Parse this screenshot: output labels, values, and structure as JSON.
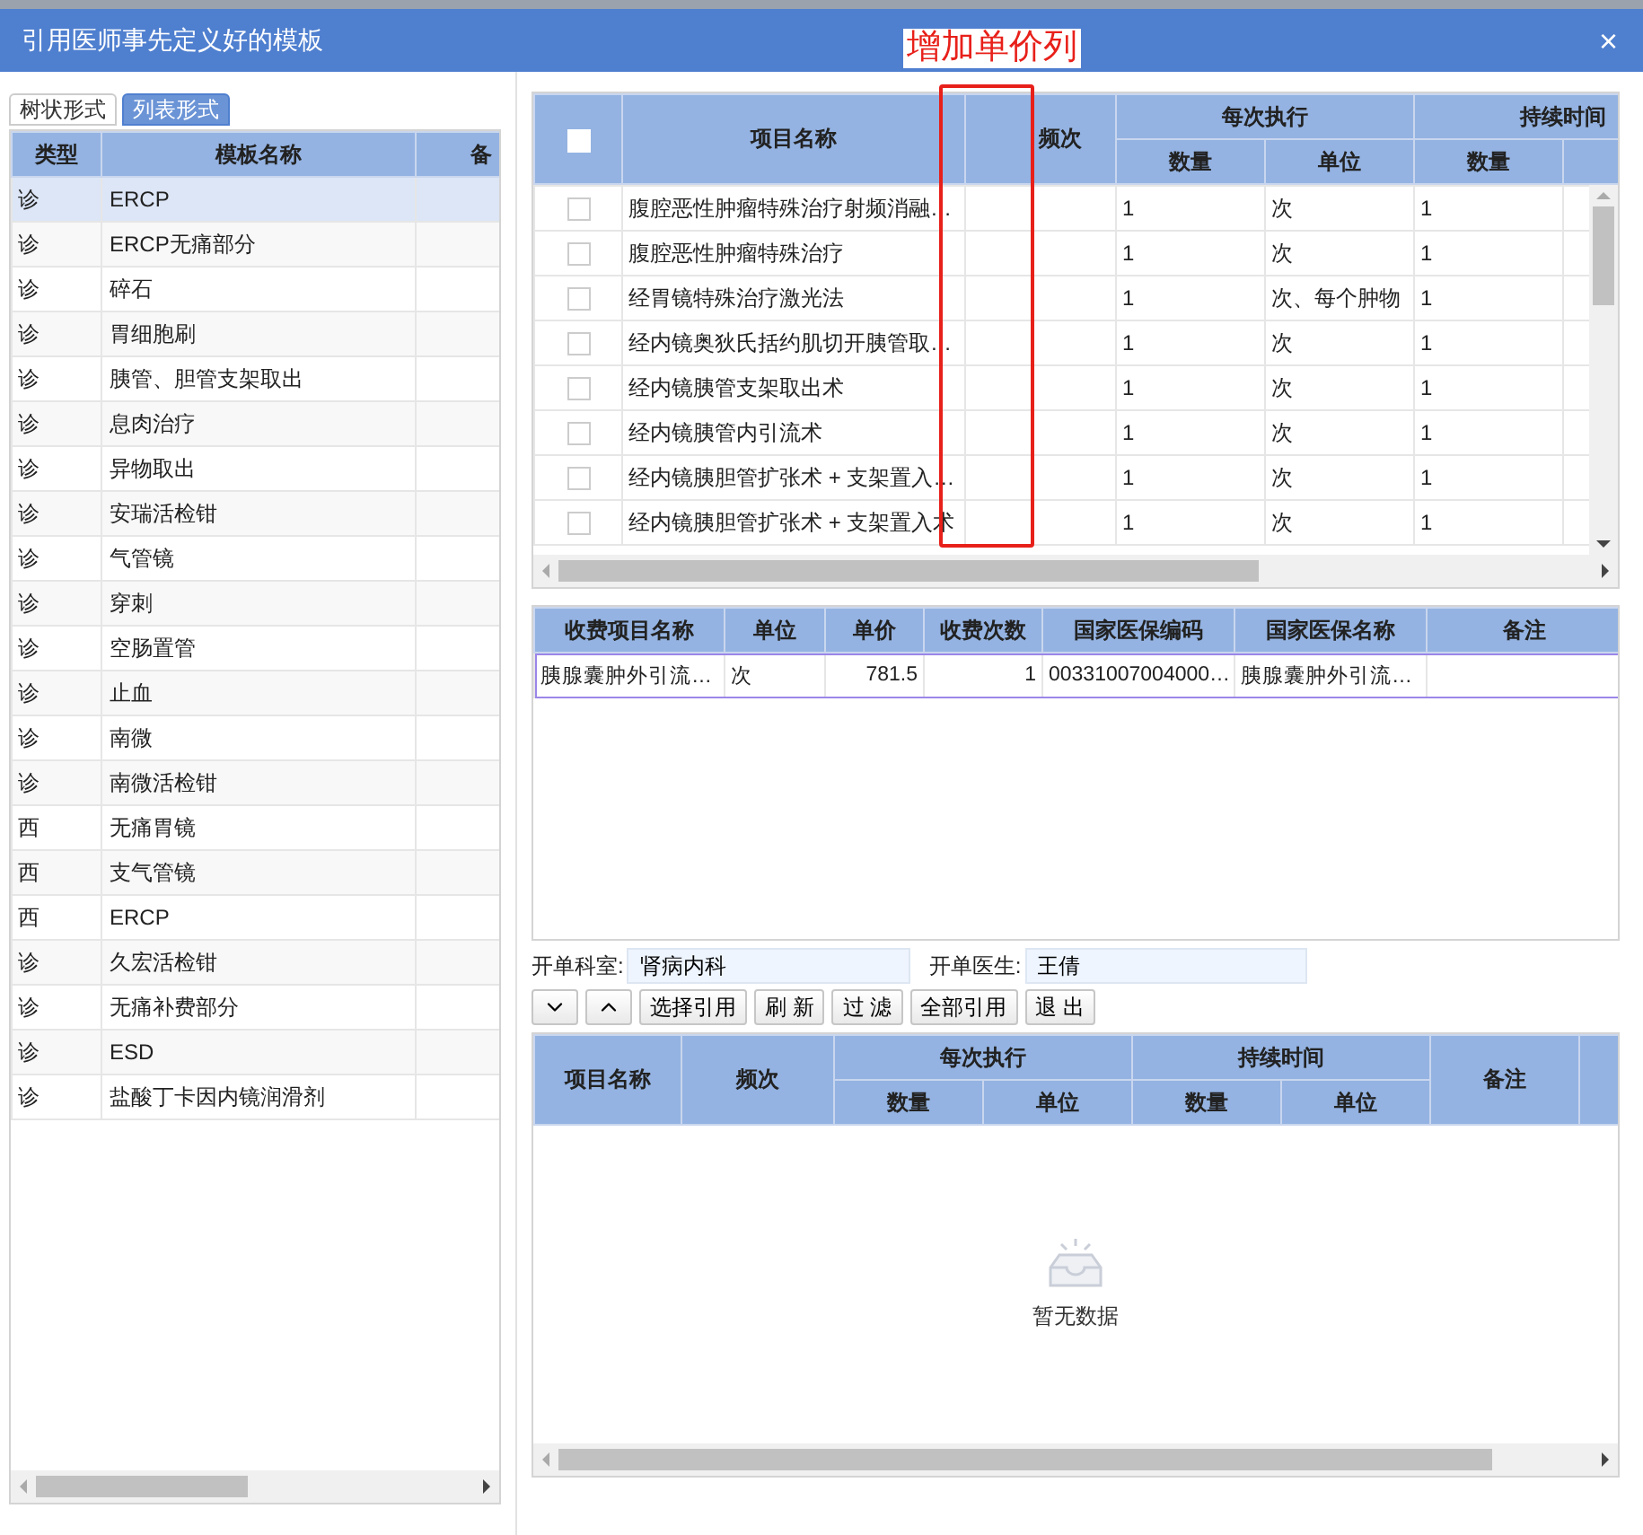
{
  "window": {
    "title": "引用医师事先定义好的模板",
    "close": "×"
  },
  "annotation": {
    "text": "增加单价列"
  },
  "templates": {
    "tabs": [
      {
        "label": "树状形式",
        "selected": false
      },
      {
        "label": "列表形式",
        "selected": true
      }
    ],
    "columns": [
      "类型",
      "模板名称",
      "备"
    ],
    "rows": [
      {
        "type": "诊",
        "name": "ERCP",
        "selected": true
      },
      {
        "type": "诊",
        "name": "ERCP无痛部分",
        "selected": false
      },
      {
        "type": "诊",
        "name": "碎石",
        "selected": false
      },
      {
        "type": "诊",
        "name": "胃细胞刷",
        "selected": false
      },
      {
        "type": "诊",
        "name": "胰管、胆管支架取出",
        "selected": false
      },
      {
        "type": "诊",
        "name": "息肉治疗",
        "selected": false
      },
      {
        "type": "诊",
        "name": "异物取出",
        "selected": false
      },
      {
        "type": "诊",
        "name": "安瑞活检钳",
        "selected": false
      },
      {
        "type": "诊",
        "name": "气管镜",
        "selected": false
      },
      {
        "type": "诊",
        "name": "穿刺",
        "selected": false
      },
      {
        "type": "诊",
        "name": "空肠置管",
        "selected": false
      },
      {
        "type": "诊",
        "name": "止血",
        "selected": false
      },
      {
        "type": "诊",
        "name": "南微",
        "selected": false
      },
      {
        "type": "诊",
        "name": "南微活检钳",
        "selected": false
      },
      {
        "type": "西",
        "name": "无痛胃镜",
        "selected": false
      },
      {
        "type": "西",
        "name": "支气管镜",
        "selected": false
      },
      {
        "type": "西",
        "name": "ERCP",
        "selected": false
      },
      {
        "type": "诊",
        "name": "久宏活检钳",
        "selected": false
      },
      {
        "type": "诊",
        "name": "无痛补费部分",
        "selected": false
      },
      {
        "type": "诊",
        "name": "ESD",
        "selected": false
      },
      {
        "type": "诊",
        "name": "盐酸丁卡因内镜润滑剂",
        "selected": false
      }
    ]
  },
  "items": {
    "header": {
      "name": "项目名称",
      "frequency": "频次",
      "per_time": "每次执行",
      "duration": "持续时间",
      "sub": [
        "数量",
        "单位",
        "数量"
      ]
    },
    "all_checked": false,
    "rows": [
      {
        "checked": false,
        "name": "腹腔恶性肿瘤特殊治疗射频消融…",
        "quantity": "1",
        "unit": "次",
        "duration": "1"
      },
      {
        "checked": false,
        "name": "腹腔恶性肿瘤特殊治疗",
        "quantity": "1",
        "unit": "次",
        "duration": "1"
      },
      {
        "checked": false,
        "name": "经胃镜特殊治疗激光法",
        "quantity": "1",
        "unit": "次、每个肿物",
        "duration": "1"
      },
      {
        "checked": false,
        "name": "经内镜奥狄氏括约肌切开胰管取…",
        "quantity": "1",
        "unit": "次",
        "duration": "1"
      },
      {
        "checked": false,
        "name": "经内镜胰管支架取出术",
        "quantity": "1",
        "unit": "次",
        "duration": "1"
      },
      {
        "checked": false,
        "name": "经内镜胰管内引流术",
        "quantity": "1",
        "unit": "次",
        "duration": "1"
      },
      {
        "checked": false,
        "name": "经内镜胰胆管扩张术 + 支架置入…",
        "quantity": "1",
        "unit": "次",
        "duration": "1"
      },
      {
        "checked": false,
        "name": "经内镜胰胆管扩张术 + 支架置入术",
        "quantity": "1",
        "unit": "次",
        "duration": "1"
      }
    ]
  },
  "charges": {
    "columns": [
      "收费项目名称",
      "单位",
      "单价",
      "收费次数",
      "国家医保编码",
      "国家医保名称",
      "备注"
    ],
    "rows": [
      {
        "selected": true,
        "cells": [
          "胰腺囊肿外引流…",
          "次",
          "781.5",
          "1",
          "00331007004000…",
          "胰腺囊肿外引流…"
        ]
      }
    ]
  },
  "form": [
    {
      "label": "开单科室:",
      "value": "肾病内科"
    },
    {
      "label": "开单医生:",
      "value": "王倩"
    }
  ],
  "buttons": [
    {
      "kind": "down"
    },
    {
      "kind": "up"
    },
    {
      "kind": "text",
      "label": "选择引用"
    },
    {
      "kind": "text",
      "label": "刷 新"
    },
    {
      "kind": "text",
      "label": "过 滤"
    },
    {
      "kind": "text",
      "label": "全部引用"
    },
    {
      "kind": "text",
      "label": "退 出"
    }
  ],
  "orders": {
    "header": {
      "name": "项目名称",
      "frequency": "频次",
      "per_time": "每次执行",
      "duration": "持续时间",
      "remark": "备注",
      "sub": [
        "数量",
        "单位",
        "数量",
        "单位"
      ]
    },
    "empty_text": "暂无数据"
  }
}
